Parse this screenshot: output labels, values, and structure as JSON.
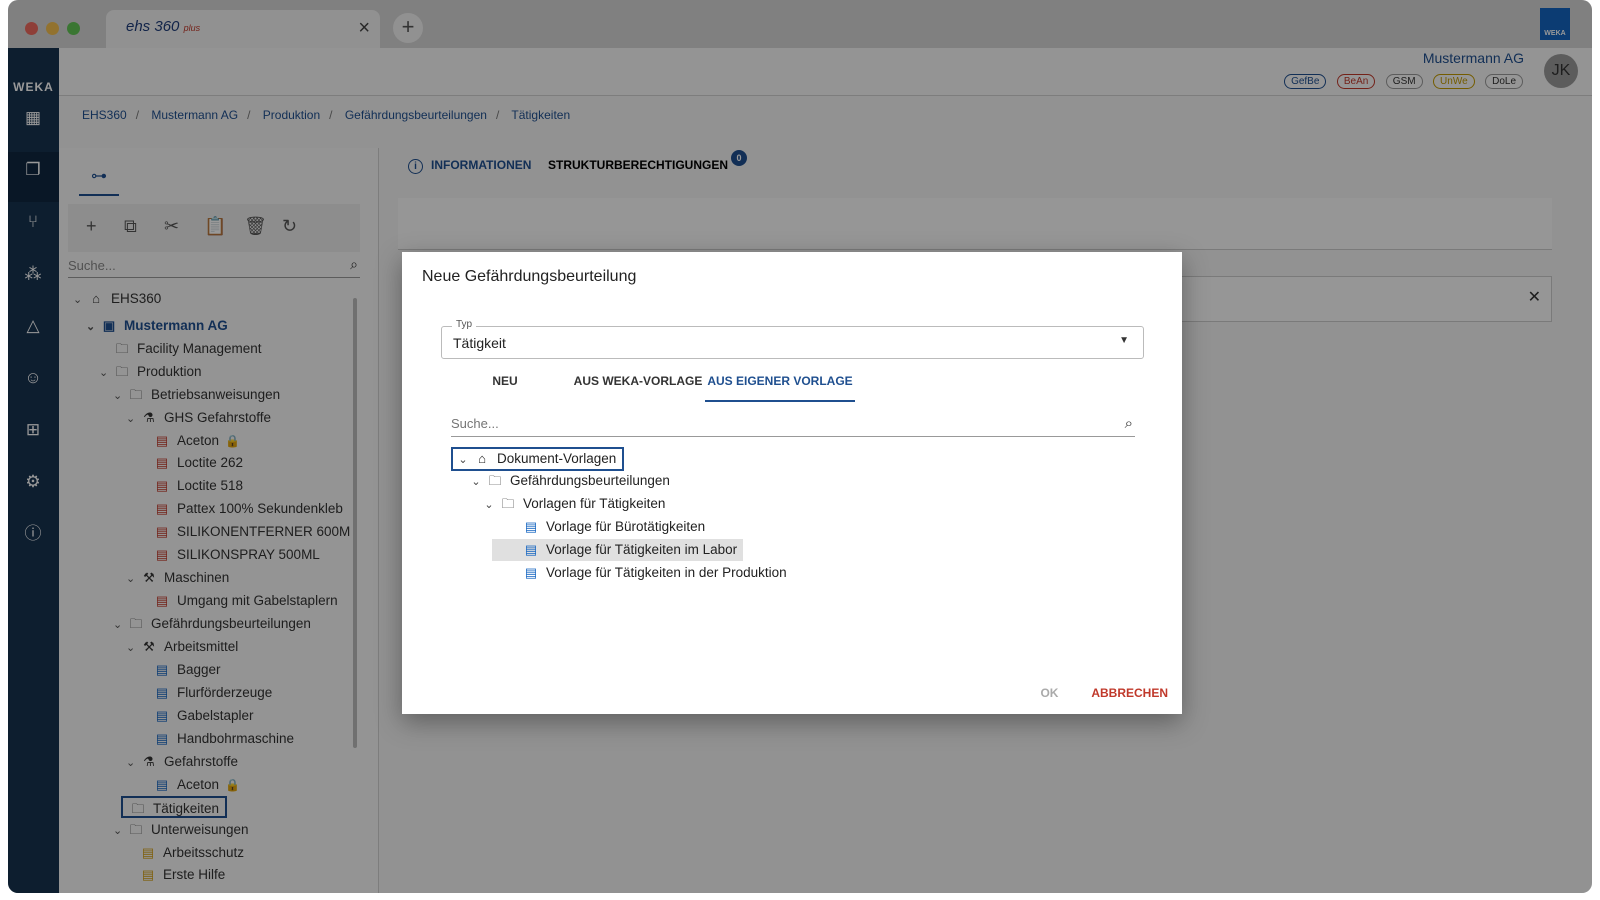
{
  "browser": {
    "tab_title": "ehs 360",
    "tab_title_suffix": "plus",
    "brand_badge": "WEKA"
  },
  "rail": {
    "logo": "WEKA"
  },
  "header": {
    "company": "Mustermann AG",
    "chips": [
      "GefBe",
      "BeAn",
      "GSM",
      "UnWe",
      "DoLe"
    ],
    "avatar_initials": "JK"
  },
  "breadcrumb": [
    "EHS360",
    "Mustermann AG",
    "Produktion",
    "Gefährdungsbeurteilungen",
    "Tätigkeiten"
  ],
  "left_panel": {
    "search_placeholder": "Suche...",
    "tree": [
      {
        "label": "EHS360"
      },
      {
        "label": "Mustermann AG"
      },
      {
        "label": "Facility Management"
      },
      {
        "label": "Produktion"
      },
      {
        "label": "Betriebsanweisungen"
      },
      {
        "label": "GHS Gefahrstoffe"
      },
      {
        "label": "Aceton"
      },
      {
        "label": "Loctite 262"
      },
      {
        "label": "Loctite 518"
      },
      {
        "label": "Pattex 100% Sekundenkleb"
      },
      {
        "label": "SILIKONENTFERNER 600M"
      },
      {
        "label": "SILIKONSPRAY 500ML"
      },
      {
        "label": "Maschinen"
      },
      {
        "label": "Umgang mit Gabelstaplern"
      },
      {
        "label": "Gefährdungsbeurteilungen"
      },
      {
        "label": "Arbeitsmittel"
      },
      {
        "label": "Bagger"
      },
      {
        "label": "Flurförderzeuge"
      },
      {
        "label": "Gabelstapler"
      },
      {
        "label": "Handbohrmaschine"
      },
      {
        "label": "Gefahrstoffe"
      },
      {
        "label": "Aceton"
      },
      {
        "label": "Tätigkeiten"
      },
      {
        "label": "Unterweisungen"
      },
      {
        "label": "Arbeitsschutz"
      },
      {
        "label": "Erste Hilfe"
      }
    ]
  },
  "main_tabs": {
    "info": "INFORMATIONEN",
    "rights": "STRUKTURBERECHTIGUNGEN",
    "rights_count": "0"
  },
  "dialog": {
    "title": "Neue Gefährdungsbeurteilung",
    "type_label": "Typ",
    "type_value": "Tätigkeit",
    "tabs": [
      "NEU",
      "AUS WEKA-VORLAGE",
      "AUS EIGENER VORLAGE"
    ],
    "active_tab": "AUS EIGENER VORLAGE",
    "search_placeholder": "Suche...",
    "tree": [
      {
        "label": "Dokument-Vorlagen"
      },
      {
        "label": "Gefährdungsbeurteilungen"
      },
      {
        "label": "Vorlagen für Tätigkeiten"
      },
      {
        "label": "Vorlage für Bürotätigkeiten"
      },
      {
        "label": "Vorlage für Tätigkeiten im Labor"
      },
      {
        "label": "Vorlage für Tätigkeiten in der Produktion"
      }
    ],
    "ok_label": "OK",
    "cancel_label": "ABBRECHEN"
  },
  "colors": {
    "rail": "#16324f",
    "accent": "#1f4f8f",
    "danger": "#c0392b"
  }
}
